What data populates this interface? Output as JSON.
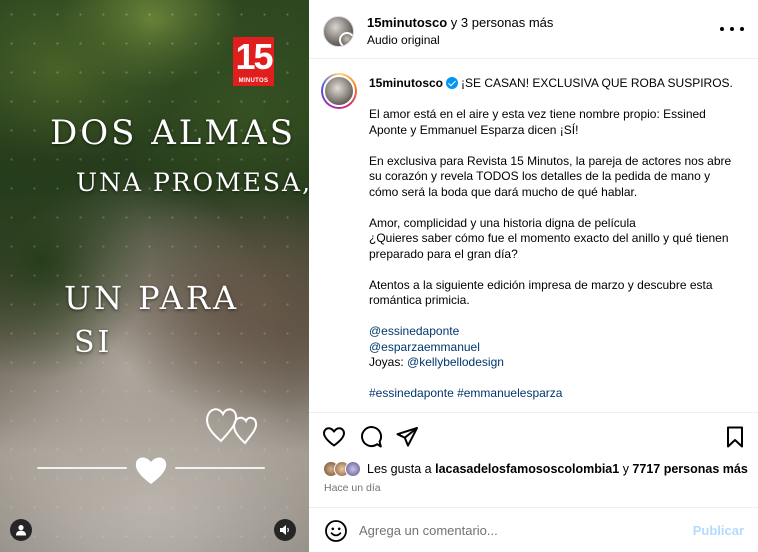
{
  "media": {
    "logo_number": "15",
    "logo_sub": "MINUTOS",
    "overlay_lines": [
      "DOS ALMAS",
      "UNA PROMESA,",
      "UN PARA",
      "SI"
    ]
  },
  "header": {
    "username": "15minutosco",
    "collab_text": " y 3 personas más",
    "audio": "Audio original"
  },
  "caption": {
    "username": "15minutosco",
    "headline": "¡SE CASAN! EXCLUSIVA QUE ROBA SUSPIROS.",
    "p1": "El amor está en el aire y esta vez tiene nombre propio: Essined Aponte y Emmanuel Esparza dicen ¡SÍ!",
    "p2": "En exclusiva para Revista 15 Minutos, la pareja de actores nos abre su corazón y revela TODOS los detalles de la pedida de mano y cómo será la boda que dará mucho de qué hablar.",
    "p3a": "Amor, complicidad y una historia digna de película",
    "p3b": "¿Quieres saber cómo fue el momento exacto del anillo y qué tienen preparado para el gran día?",
    "p4": "Atentos a la siguiente edición impresa de marzo y descubre esta romántica primicia.",
    "mention1": "@essinedaponte",
    "mention2": "@esparzaemmanuel",
    "jewelry_label": "Joyas: ",
    "mention3": "@kellybellodesign",
    "hashtags": "#essinedaponte #emmanuelesparza"
  },
  "likes": {
    "prefix": "Les gusta a ",
    "user": "lacasadelosfamososcolombia1",
    "middle": " y ",
    "count": "7717 personas más"
  },
  "time": "Hace un día",
  "comment": {
    "placeholder": "Agrega un comentario...",
    "publish": "Publicar"
  },
  "colors": {
    "link": "#00376b",
    "verified": "#0095f6",
    "publish_disabled": "#b3dbff",
    "logo_red": "#e01e1e"
  },
  "icons": [
    "heart-icon",
    "comment-icon",
    "share-icon",
    "bookmark-icon",
    "more-icon",
    "emoji-icon",
    "user-tag-icon",
    "sound-icon"
  ]
}
